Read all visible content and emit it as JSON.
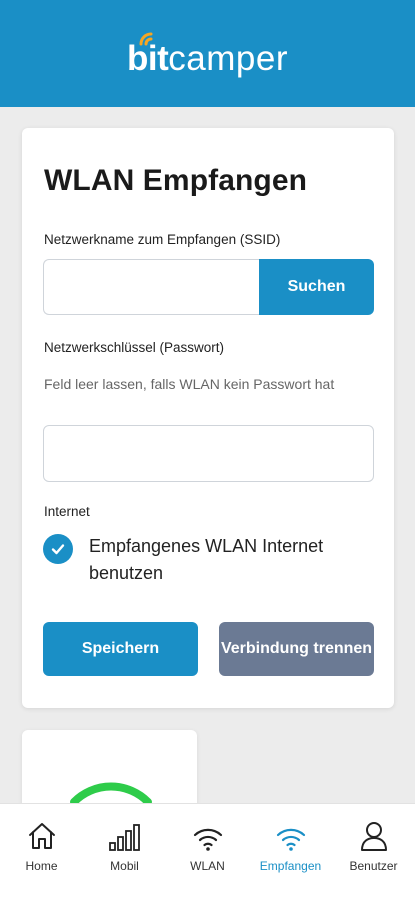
{
  "header": {
    "logo_bit": "bit",
    "logo_camper": "camper",
    "brand_color": "#1a8fc6",
    "signal_color": "#f5a623"
  },
  "form": {
    "title": "WLAN Empfangen",
    "ssid": {
      "label": "Netzwerkname zum Empfangen (SSID)",
      "value": "",
      "placeholder": ""
    },
    "search_label": "Suchen",
    "password": {
      "label": "Netzwerkschlüssel (Passwort)",
      "help": "Feld leer lassen, falls WLAN kein Passwort hat",
      "value": "",
      "placeholder": ""
    },
    "internet": {
      "label": "Internet",
      "checkbox_label": "Empfangenes WLAN Internet benutzen",
      "checked": true
    },
    "save_label": "Speichern",
    "disconnect_label": "Verbindung trennen",
    "disconnect_color": "#6b7a94"
  },
  "status_card": {
    "icon": "wifi-icon",
    "color": "#2ecc4a"
  },
  "nav": {
    "items": [
      {
        "label": "Home",
        "icon": "home-icon",
        "active": false
      },
      {
        "label": "Mobil",
        "icon": "signal-bars-icon",
        "active": false
      },
      {
        "label": "WLAN",
        "icon": "wifi-icon",
        "active": false
      },
      {
        "label": "Empfangen",
        "icon": "wifi-receive-icon",
        "active": true
      },
      {
        "label": "Benutzer",
        "icon": "user-icon",
        "active": false
      }
    ]
  }
}
